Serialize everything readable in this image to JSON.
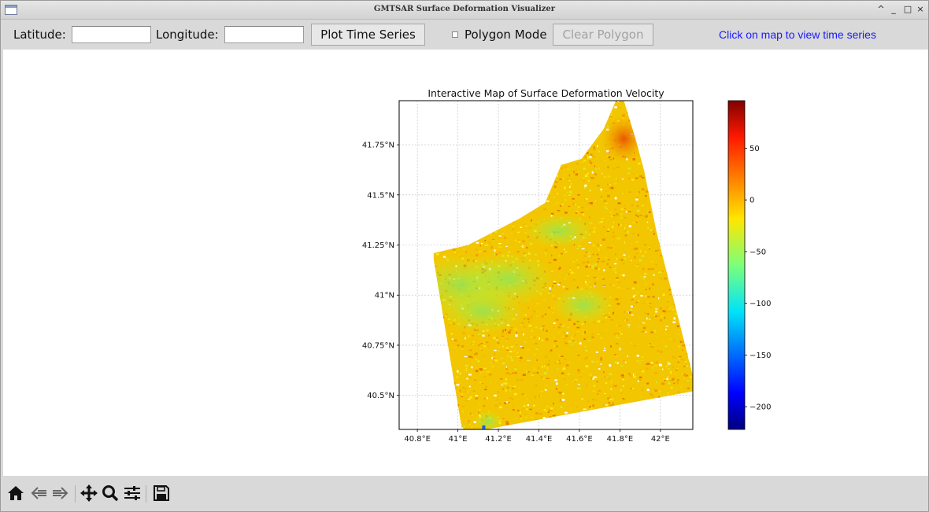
{
  "window": {
    "title": "GMTSAR Surface Deformation Visualizer",
    "controls": [
      "^",
      "_",
      "□",
      "×"
    ]
  },
  "toolbar": {
    "latitude_label": "Latitude:",
    "latitude_value": "",
    "longitude_label": "Longitude:",
    "longitude_value": "",
    "plot_button": "Plot Time Series",
    "polygon_mode_label": "Polygon Mode",
    "polygon_mode_checked": false,
    "clear_polygon_button": "Clear Polygon",
    "status": "Click on map to view time series",
    "status_color": "#1a1aff"
  },
  "nav_toolbar": {
    "icons": [
      "home-icon",
      "back-icon",
      "forward-icon",
      "pan-icon",
      "zoom-icon",
      "configure-subplots-icon",
      "save-icon"
    ]
  },
  "chart_data": {
    "type": "heatmap",
    "title": "Interactive Map of Surface Deformation Velocity",
    "xlabel": "",
    "ylabel": "",
    "x_ticks": [
      "40.8°E",
      "41°E",
      "41.2°E",
      "41.4°E",
      "41.6°E",
      "41.8°E",
      "42°E"
    ],
    "x_tick_values": [
      40.8,
      41.0,
      41.2,
      41.4,
      41.6,
      41.8,
      42.0
    ],
    "y_ticks": [
      "41.75°N",
      "41.5°N",
      "41.25°N",
      "41°N",
      "40.75°N",
      "40.5°N"
    ],
    "y_tick_values": [
      41.75,
      41.5,
      41.25,
      41.0,
      40.75,
      40.5
    ],
    "xlim": [
      40.71,
      42.16
    ],
    "ylim": [
      40.33,
      41.97
    ],
    "grid": true,
    "colorbar": {
      "colormap": "jet",
      "range": [
        -222,
        96
      ],
      "ticks": [
        50,
        0,
        -50,
        -100,
        -150,
        -200
      ],
      "tick_labels": [
        "50",
        "0",
        "−50",
        "−100",
        "−150",
        "−200"
      ]
    },
    "footprint_lonlat": [
      [
        41.02,
        40.33
      ],
      [
        41.14,
        40.33
      ],
      [
        42.16,
        40.52
      ],
      [
        42.16,
        40.6
      ],
      [
        41.98,
        41.32
      ],
      [
        41.92,
        41.62
      ],
      [
        41.88,
        41.77
      ],
      [
        41.82,
        41.97
      ],
      [
        41.78,
        41.97
      ],
      [
        41.72,
        41.83
      ],
      [
        41.61,
        41.68
      ],
      [
        41.51,
        41.65
      ],
      [
        41.43,
        41.46
      ],
      [
        41.3,
        41.38
      ],
      [
        41.05,
        41.25
      ],
      [
        40.88,
        41.21
      ],
      [
        40.88,
        41.18
      ]
    ],
    "dominant_values": "mostly -30 to 40 (yellow/orange), higher ~60-80 in the northern tip, lower ~-60 to -100 in scattered central/western patches"
  }
}
